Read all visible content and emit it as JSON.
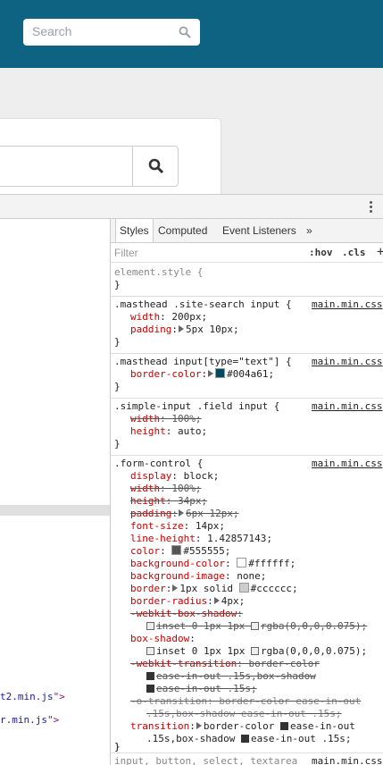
{
  "masthead": {
    "search_placeholder": "Search",
    "brand_color": "#0e6383"
  },
  "devtools": {
    "left_links": [
      {
        "text": "t2.min.js",
        "quote": "\">"
      },
      {
        "text": "r.min.js",
        "quote": "\">"
      }
    ],
    "tabs": [
      "Styles",
      "Computed",
      "Event Listeners",
      "»"
    ],
    "filter_placeholder": "Filter",
    "hov": ":hov",
    "cls": ".cls",
    "plus": "+",
    "element_style": {
      "selector": "element.style {",
      "close": "}"
    },
    "rule1": {
      "selector": ".masthead .site-search input {",
      "source": "main.min.css",
      "width_name": "width",
      "width_value": "200px;",
      "padding_name": "padding",
      "padding_value": "5px 10px;",
      "close": "}"
    },
    "rule2": {
      "selector": ".masthead input[type=\"text\"] {",
      "source": "main.min.css",
      "border_color_name": "border-color",
      "border_color_value": "#004a61;",
      "swatch": "#004a61",
      "close": "}"
    },
    "rule3": {
      "selector": ".simple-input .field input {",
      "source": "main.min.css",
      "width_name": "width",
      "width_value": "100%;",
      "height_name": "height",
      "height_value": "auto;",
      "close": "}"
    },
    "rule4": {
      "selector": ".form-control {",
      "source": "main.min.css",
      "display": [
        "display",
        "block;"
      ],
      "width": [
        "width",
        "100%;"
      ],
      "height": [
        "height",
        "34px;"
      ],
      "padding": [
        "padding",
        "6px 12px;"
      ],
      "font_size": [
        "font-size",
        "14px;"
      ],
      "line_height": [
        "line-height",
        "1.42857143;"
      ],
      "color": [
        "color",
        "#555555;"
      ],
      "color_swatch": "#555555",
      "bg_color": [
        "background-color",
        "#ffffff;"
      ],
      "bg_swatch": "#ffffff",
      "bg_image": [
        "background-image",
        "none;"
      ],
      "border": [
        "border",
        "1px solid",
        "#cccccc;"
      ],
      "border_swatch": "#cccccc",
      "border_radius": [
        "border-radius",
        "4px;"
      ],
      "wk_shadow_name": "-webkit-box-shadow",
      "wk_shadow_value": "inset 0 1px 1px",
      "wk_shadow_rgba": "rgba(0,0,0,0.075);",
      "shadow_name": "box-shadow",
      "shadow_value": "inset 0 1px 1px",
      "shadow_rgba": "rgba(0,0,0,0.075);",
      "wk_transition_name": "-webkit-transition",
      "wk_transition_value": "border-color",
      "wk_transition_l2": "ease-in-out .15s,box-shadow",
      "wk_transition_l3": "ease-in-out .15s;",
      "o_transition_name": "-o-transition",
      "o_transition_value": "border-color ease-in-out",
      "o_transition_l2": ".15s,box-shadow ease-in-out .15s;",
      "transition_name": "transition",
      "transition_value": "border-color",
      "transition_ease1": "ease-in-out",
      "transition_l2a": ".15s,box-shadow",
      "transition_l2b": "ease-in-out .15s;",
      "close": "}"
    },
    "rule5": {
      "selector": "input, button, select, textarea",
      "source": "main.min.css"
    }
  }
}
